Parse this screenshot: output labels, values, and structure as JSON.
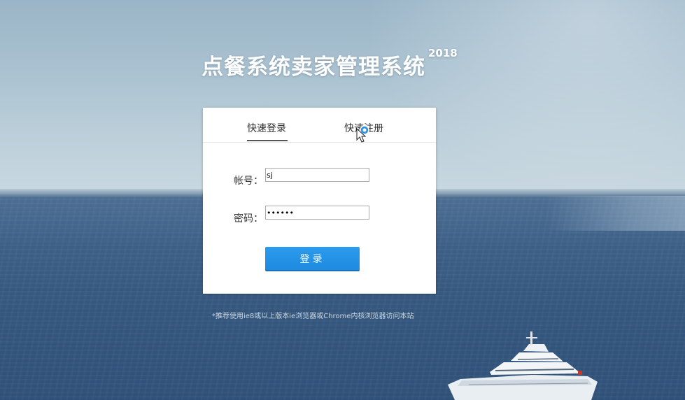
{
  "header": {
    "title": "点餐系统卖家管理系统",
    "year": "2018"
  },
  "tabs": [
    {
      "label": "快速登录",
      "active": true
    },
    {
      "label": "快速注册",
      "active": false
    }
  ],
  "form": {
    "username_label": "帐号：",
    "username_value": "sj",
    "password_label": "密码：",
    "password_value": "••••••",
    "submit_label": "登录"
  },
  "footer": {
    "note": "*推荐使用ie8或以上版本ie浏览器或Chrome内核浏览器访问本站"
  },
  "colors": {
    "accent": "#1f8ae0",
    "panel": "#ffffff"
  }
}
